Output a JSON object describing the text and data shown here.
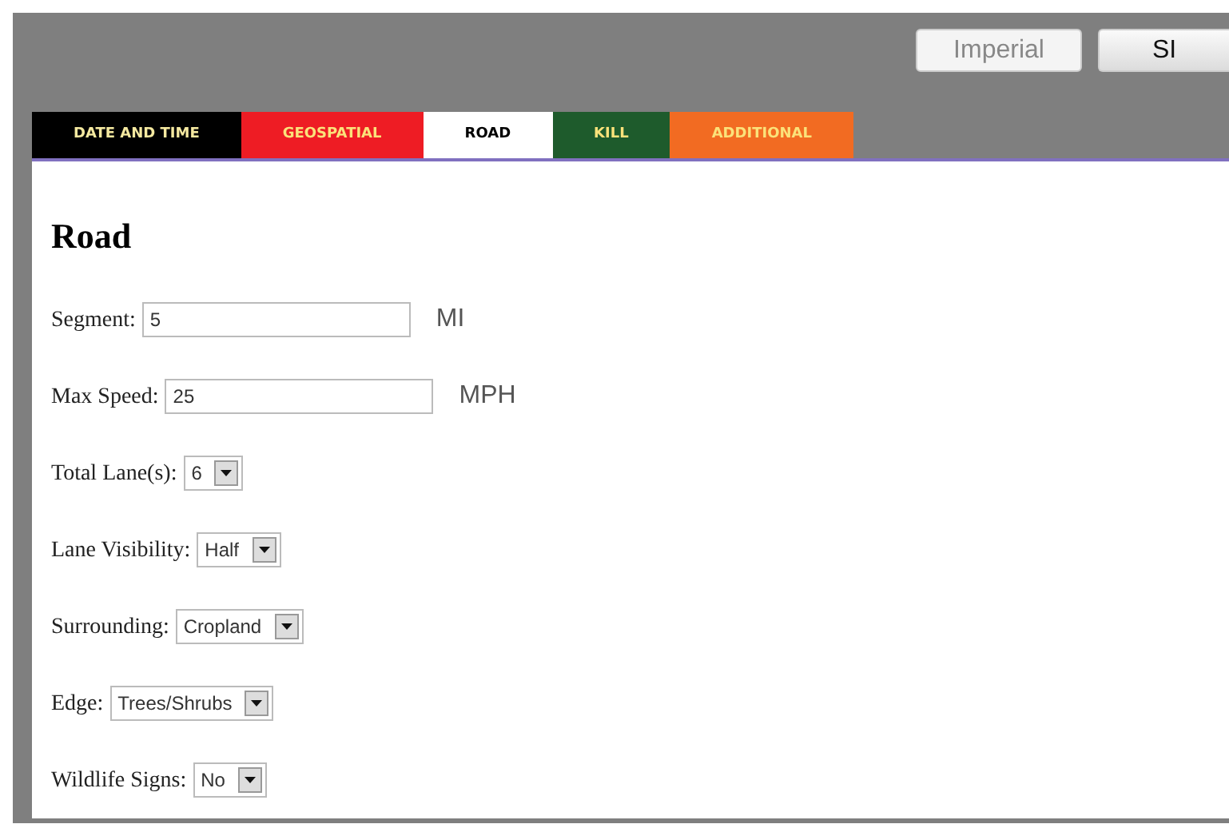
{
  "units": [
    {
      "label": "Imperial",
      "selected": true
    },
    {
      "label": "SI",
      "selected": false
    }
  ],
  "tabs": [
    {
      "label": "DATE AND TIME",
      "selected": false,
      "color": "#000000"
    },
    {
      "label": "GEOSPATIAL",
      "selected": false,
      "color": "#ee1c24"
    },
    {
      "label": "ROAD",
      "selected": true,
      "color": "#ffffff"
    },
    {
      "label": "KILL",
      "selected": false,
      "color": "#1e5b2c"
    },
    {
      "label": "ADDITIONAL",
      "selected": false,
      "color": "#f26b22"
    }
  ],
  "heading": "Road",
  "fields": [
    {
      "kind": "text",
      "label": "Segment:",
      "value": "5",
      "unit": "MI"
    },
    {
      "kind": "text",
      "label": "Max Speed:",
      "value": "25",
      "unit": "MPH"
    },
    {
      "kind": "select",
      "label": "Total Lane(s):",
      "value": "6"
    },
    {
      "kind": "select",
      "label": "Lane Visibility:",
      "value": "Half"
    },
    {
      "kind": "select",
      "label": "Surrounding:",
      "value": "Cropland"
    },
    {
      "kind": "select",
      "label": "Edge:",
      "value": "Trees/Shrubs"
    },
    {
      "kind": "select",
      "label": "Wildlife Signs:",
      "value": "No"
    }
  ]
}
